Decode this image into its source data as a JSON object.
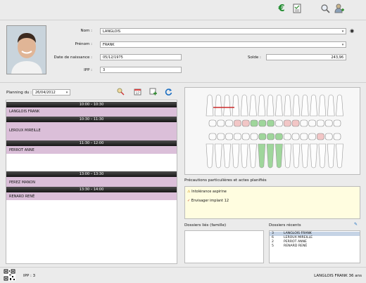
{
  "toolbar": {
    "icons": [
      "euro-icon",
      "checklist-icon",
      "search-icon",
      "add-user-icon"
    ],
    "euro_glyph": "€"
  },
  "patient": {
    "nom_label": "Nom :",
    "nom_value": "LANGLOIS",
    "prenom_label": "Prénom :",
    "prenom_value": "FRANK",
    "dob_label": "Date de naissance :",
    "dob_value": "05/12/1975",
    "solde_label": "Solde :",
    "solde_value": "243,96",
    "ipp_label": "IPP :",
    "ipp_value": "3"
  },
  "planning": {
    "label": "Planning du :",
    "date": "26/04/2012",
    "slots": [
      {
        "time": "10:00 – 10:30",
        "patient": "LANGLOIS FRANK"
      },
      {
        "time": "10:30 – 11:30",
        "patient": "LEROUX MIREILLE"
      },
      {
        "time": "11:30 – 12:00",
        "patient": "PERROT ANNE"
      },
      {
        "time": "13:00 – 13:30",
        "patient": "PEREZ MANON"
      },
      {
        "time": "13:30 – 14:00",
        "patient": "RENARD RENÉ"
      }
    ]
  },
  "precautions": {
    "title": "Précautions particulières et actes planifiés",
    "items": [
      {
        "icon": "warning-icon",
        "text": "Intolérance aspirine"
      },
      {
        "icon": "check-icon",
        "text": "Envisager implant 12"
      }
    ]
  },
  "dossiers_lies": {
    "title": "Dossiers liés (famille)"
  },
  "dossiers_recents": {
    "title": "Dossiers récents",
    "rows": [
      {
        "id": "3",
        "name": "LANGLOIS FRANK"
      },
      {
        "id": "6",
        "name": "LEROUX MIREILLE"
      },
      {
        "id": "2",
        "name": "PERROT ANNE"
      },
      {
        "id": "5",
        "name": "RENARD RENÉ"
      }
    ]
  },
  "footer": {
    "ipp": "IPP :  3",
    "patient": "LANGLOIS  FRANK  36 ans"
  },
  "colors": {
    "appointment": "#dbbfd9",
    "slot_bar": "#2a2a2a",
    "selected_row": "#c5d3e5",
    "notes_bg": "#fffde0",
    "euro": "#1b8a2a",
    "refresh": "#1c6fc2"
  }
}
